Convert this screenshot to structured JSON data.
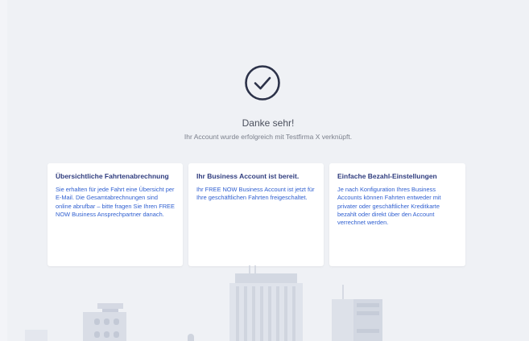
{
  "confirmation": {
    "title": "Danke sehr!",
    "subtitle": "Ihr Account wurde erfolgreich mit Testfirma X verknüpft."
  },
  "cards": [
    {
      "title": "Übersichtliche Fahrtenabrechnung",
      "text": "Sie erhalten für jede Fahrt eine Übersicht per E-Mail. Die Gesamtabrechnungen sind online abrufbar – bitte fragen Sie Ihren FREE NOW Business Ansprechpartner danach."
    },
    {
      "title": "Ihr Business Account ist bereit.",
      "text": "Ihr FREE NOW Business Account ist jetzt für Ihre geschäftlichen Fahrten freigeschaltet."
    },
    {
      "title": "Einfache Bezahl-Einstellungen",
      "text": "Je nach Konfiguration Ihres Business Accounts können Fahrten entweder mit privater oder geschäftlicher Kreditkarte bezahlt oder direkt über den Account verrechnet werden."
    }
  ],
  "colors": {
    "background": "#eff1f5",
    "card_title": "#2f3c7e",
    "card_text": "#2f5fd0",
    "icon": "#2c3249"
  },
  "icons": {
    "confirmation": "check-circle-icon"
  }
}
